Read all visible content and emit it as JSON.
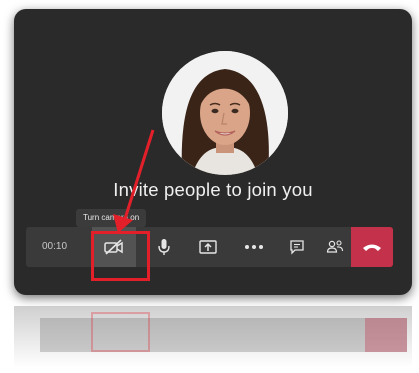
{
  "meeting": {
    "invite_text": "Invite people to join you",
    "timer": "00:10"
  },
  "tooltip": {
    "text": "Turn camera on"
  },
  "toolbar": {
    "buttons": [
      {
        "name": "camera-toggle",
        "icon": "camera-off-icon",
        "state": "off"
      },
      {
        "name": "microphone",
        "icon": "microphone-icon"
      },
      {
        "name": "share-screen",
        "icon": "share-screen-icon"
      },
      {
        "name": "more-options",
        "icon": "more-icon"
      },
      {
        "name": "chat",
        "icon": "chat-icon"
      },
      {
        "name": "participants",
        "icon": "participants-icon"
      },
      {
        "name": "hang-up",
        "icon": "hang-up-icon"
      }
    ]
  },
  "colors": {
    "window_bg": "#2a2a2a",
    "toolbar_bg": "#3a3a3a",
    "hangup_red": "#c4314b",
    "annotation_red": "#e3202a"
  }
}
